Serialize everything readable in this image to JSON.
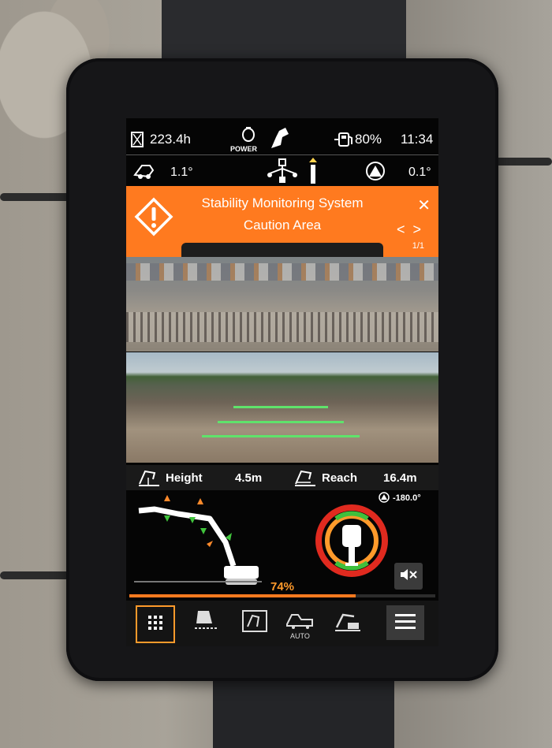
{
  "status_bar": {
    "hours": "223.4h",
    "power_label": "POWER",
    "fuel": "80%",
    "time": "11:34"
  },
  "incline": {
    "left_angle": "1.1°",
    "right_angle": "0.1°"
  },
  "alert": {
    "title": "Stability Monitoring System",
    "subtitle": "Caution Area",
    "page": "1/1",
    "close": "✕",
    "prev": "<",
    "next": ">"
  },
  "measurements": {
    "height_label": "Height",
    "height_value": "4.5m",
    "reach_label": "Reach",
    "reach_value": "16.4m"
  },
  "swing": {
    "angle": "-180.0°"
  },
  "stability": {
    "percent_label": "74%",
    "percent": 74
  },
  "nav": {
    "auto_label": "AUTO"
  },
  "colors": {
    "accent_orange": "#ff7a1f",
    "guide_green": "#5fe36b",
    "ring_red": "#e02a1f",
    "ring_green": "#3fbf3c"
  }
}
